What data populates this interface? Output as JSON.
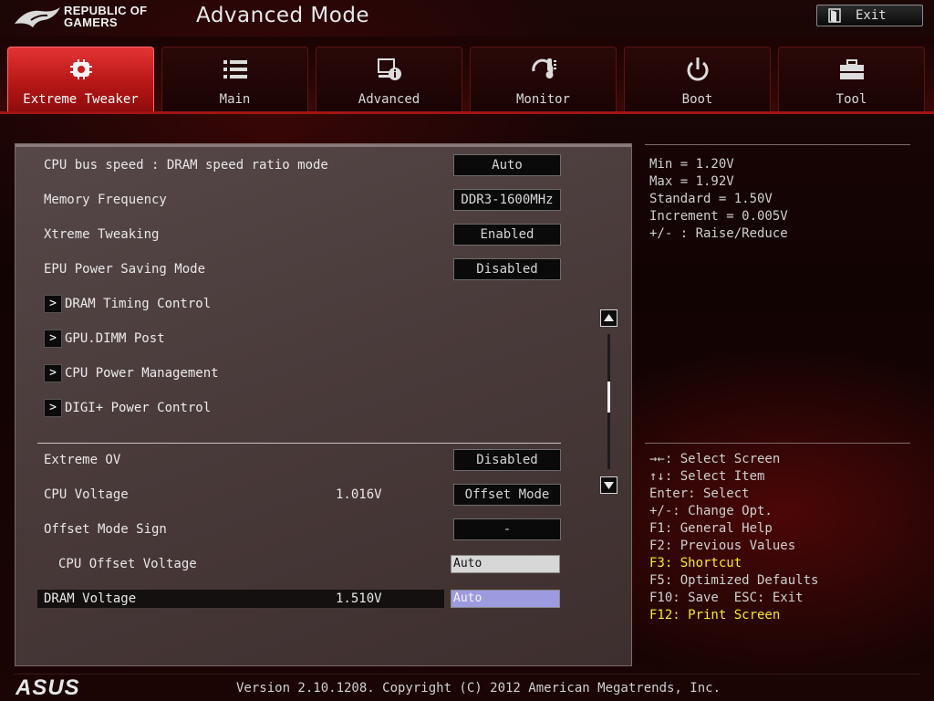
{
  "header": {
    "brand_line1": "REPUBLIC OF",
    "brand_line2": "GAMERS",
    "title": "Advanced Mode",
    "exit_label": "Exit"
  },
  "tabs": [
    {
      "label": "Extreme Tweaker",
      "icon": "tweaker-icon",
      "active": true
    },
    {
      "label": "Main",
      "icon": "list-icon",
      "active": false
    },
    {
      "label": "Advanced",
      "icon": "advanced-icon",
      "active": false
    },
    {
      "label": "Monitor",
      "icon": "monitor-icon",
      "active": false
    },
    {
      "label": "Boot",
      "icon": "power-icon",
      "active": false
    },
    {
      "label": "Tool",
      "icon": "toolbox-icon",
      "active": false
    }
  ],
  "settings": {
    "cpu_bus_ratio": {
      "label": "CPU bus speed : DRAM speed ratio mode",
      "value": "Auto"
    },
    "memory_frequency": {
      "label": "Memory Frequency",
      "value": "DDR3-1600MHz"
    },
    "xtreme_tweaking": {
      "label": "Xtreme Tweaking",
      "value": "Enabled"
    },
    "epu_power_saving": {
      "label": "EPU Power Saving Mode",
      "value": "Disabled"
    },
    "submenus": [
      "DRAM Timing Control",
      "GPU.DIMM Post",
      "CPU Power Management",
      "DIGI+ Power Control"
    ],
    "extreme_ov": {
      "label": "Extreme OV",
      "value": "Disabled"
    },
    "cpu_voltage": {
      "label": "CPU Voltage",
      "reading": "1.016V",
      "value": "Offset Mode"
    },
    "offset_mode_sign": {
      "label": "Offset Mode Sign",
      "value": "-"
    },
    "cpu_offset_voltage": {
      "label": "CPU Offset Voltage",
      "value": "Auto"
    },
    "dram_voltage": {
      "label": "DRAM Voltage",
      "reading": "1.510V",
      "value": "Auto"
    }
  },
  "info": {
    "min": "Min = 1.20V",
    "max": "Max = 1.92V",
    "standard": "Standard = 1.50V",
    "increment": "Increment = 0.005V",
    "raise_reduce": "+/- : Raise/Reduce"
  },
  "help": {
    "select_screen": "→←: Select Screen",
    "select_item": "↑↓: Select Item",
    "enter_select": "Enter: Select",
    "change_opt": "+/-: Change Opt.",
    "f1": "F1: General Help",
    "f2": "F2: Previous Values",
    "f3": "F3: Shortcut",
    "f5": "F5: Optimized Defaults",
    "f10": "F10: Save  ESC: Exit",
    "f12": "F12: Print Screen"
  },
  "footer": {
    "brand": "ASUS",
    "version": "Version 2.10.1208. Copyright (C) 2012 American Megatrends, Inc."
  },
  "colors": {
    "active_tab": "#d62424",
    "highlight_text": "#f6ea2c",
    "selected_field": "#9d9be0"
  }
}
